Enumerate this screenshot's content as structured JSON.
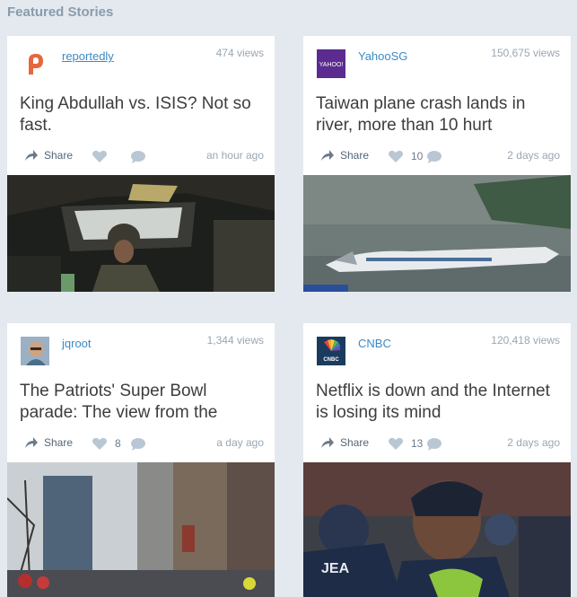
{
  "section": {
    "title": "Featured Stories"
  },
  "stories": [
    {
      "source": "reportedly",
      "views": "474 views",
      "headline": "King Abdullah vs. ISIS? Not so fast.",
      "share_label": "Share",
      "likes": "",
      "time": "an hour ago",
      "accent": "#e8663d"
    },
    {
      "source": "YahooSG",
      "views": "150,675 views",
      "headline": "Taiwan plane crash lands in river, more than 10 hurt",
      "share_label": "Share",
      "likes": "10",
      "time": "2 days ago",
      "accent": "#5c2b8f",
      "logo_text": "YAHOO!"
    },
    {
      "source": "jqroot",
      "views": "1,344 views",
      "headline": "The Patriots' Super Bowl parade: The view from the",
      "share_label": "Share",
      "likes": "8",
      "time": "a day ago",
      "accent": "#c9a27a"
    },
    {
      "source": "CNBC",
      "views": "120,418 views",
      "headline": "Netflix is down and the Internet is losing its mind",
      "share_label": "Share",
      "likes": "13",
      "time": "2 days ago",
      "accent": "#1b3b5e",
      "logo_text": "CNBC",
      "thumb_text": "JEA"
    }
  ],
  "icons": {
    "share": "share-arrow-icon",
    "like": "heart-icon",
    "comment": "comment-bubble-icon"
  },
  "colors": {
    "background": "#e3e9ef",
    "link": "#3b8bc4",
    "muted": "#9aa6b2"
  }
}
